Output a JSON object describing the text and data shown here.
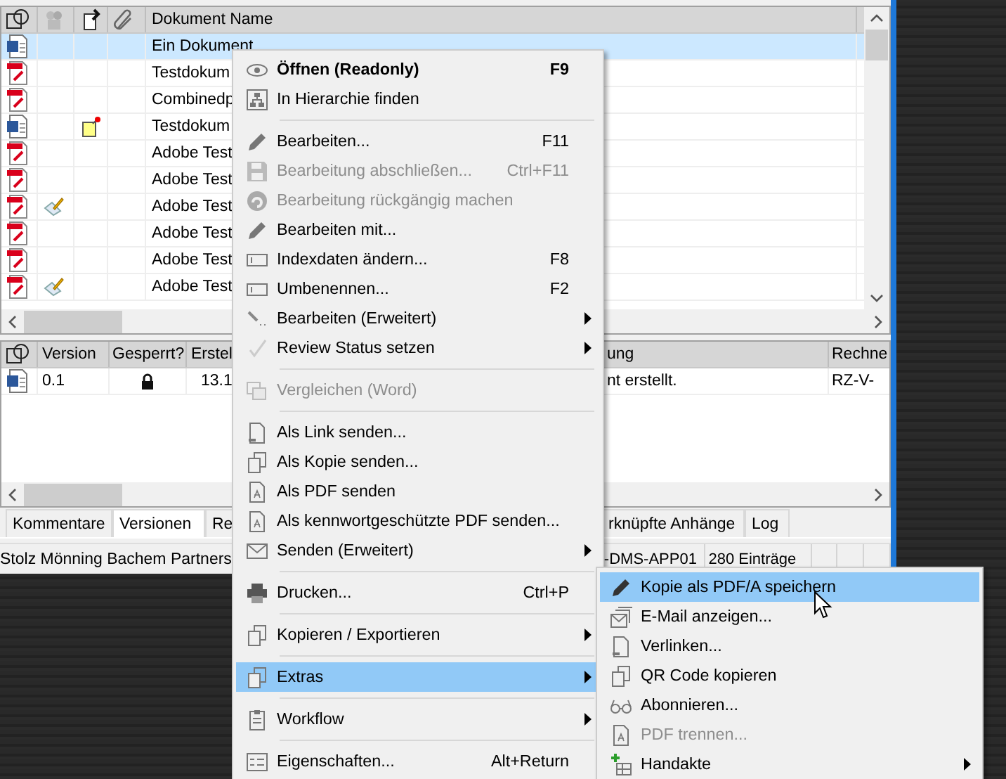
{
  "document_table": {
    "name_column": "Dokument Name",
    "rows": [
      {
        "kind": "word",
        "name": "Ein Dokument",
        "selected": true,
        "edited": false,
        "note": false
      },
      {
        "kind": "pdf",
        "name": "Testdokum",
        "selected": false,
        "edited": false,
        "note": false
      },
      {
        "kind": "pdf",
        "name": "Combinedp",
        "selected": false,
        "edited": false,
        "note": false
      },
      {
        "kind": "word",
        "name": "Testdokum",
        "selected": false,
        "edited": false,
        "note": true
      },
      {
        "kind": "pdf",
        "name": "Adobe Test",
        "selected": false,
        "edited": false,
        "note": false
      },
      {
        "kind": "pdf",
        "name": "Adobe Test",
        "selected": false,
        "edited": false,
        "note": false
      },
      {
        "kind": "pdf",
        "name": "Adobe Test",
        "selected": false,
        "edited": true,
        "note": false
      },
      {
        "kind": "pdf",
        "name": "Adobe Test",
        "selected": false,
        "edited": false,
        "note": false
      },
      {
        "kind": "pdf",
        "name": "Adobe Test",
        "selected": false,
        "edited": false,
        "note": false
      },
      {
        "kind": "pdf",
        "name": "Adobe Test",
        "selected": false,
        "edited": true,
        "note": false
      }
    ]
  },
  "version_table": {
    "columns": [
      "Version",
      "Gesperrt?",
      "Erstel",
      "ung",
      "Rechne"
    ],
    "rows": [
      {
        "kind": "word",
        "version": "0.1",
        "locked": true,
        "column_3": "13.1",
        "column_4": "nt erstellt.",
        "column_5": "RZ-V-"
      }
    ]
  },
  "tabs": [
    {
      "label": "Kommentare",
      "selected": false
    },
    {
      "label": "Versionen",
      "selected": true
    },
    {
      "label": "Re",
      "selected": false
    },
    {
      "label": "rknüpfte Anhänge",
      "selected": false
    },
    {
      "label": "Log",
      "selected": false
    }
  ],
  "status_bar": [
    "Stolz Mönning Bachem Partners",
    "-DMS-APP01",
    "280 Einträge"
  ],
  "context_menu": [
    {
      "kind": "item",
      "label": "Öffnen (Readonly)",
      "shortcut": "F9",
      "default": true,
      "disabled": false,
      "submenu": false,
      "selected": false
    },
    {
      "kind": "item",
      "label": "In Hierarchie finden",
      "disabled": false,
      "submenu": false,
      "selected": false
    },
    {
      "kind": "separator"
    },
    {
      "kind": "item",
      "label": "Bearbeiten...",
      "shortcut": "F11",
      "disabled": false,
      "submenu": false,
      "selected": false
    },
    {
      "kind": "item",
      "label": "Bearbeitung abschließen...",
      "shortcut": "Ctrl+F11",
      "disabled": true,
      "submenu": false,
      "selected": false
    },
    {
      "kind": "item",
      "label": "Bearbeitung rückgängig machen",
      "disabled": true,
      "submenu": false,
      "selected": false
    },
    {
      "kind": "item",
      "label": "Bearbeiten mit...",
      "disabled": false,
      "submenu": false,
      "selected": false
    },
    {
      "kind": "item",
      "label": "Indexdaten ändern...",
      "shortcut": "F8",
      "disabled": false,
      "submenu": false,
      "selected": false
    },
    {
      "kind": "item",
      "label": "Umbenennen...",
      "shortcut": "F2",
      "disabled": false,
      "submenu": false,
      "selected": false
    },
    {
      "kind": "item",
      "label": "Bearbeiten (Erweitert)",
      "disabled": false,
      "submenu": true,
      "selected": false
    },
    {
      "kind": "item",
      "label": "Review Status setzen",
      "disabled": false,
      "submenu": true,
      "selected": false
    },
    {
      "kind": "separator"
    },
    {
      "kind": "item",
      "label": "Vergleichen (Word)",
      "disabled": true,
      "submenu": false,
      "selected": false
    },
    {
      "kind": "separator"
    },
    {
      "kind": "item",
      "label": "Als Link senden...",
      "disabled": false,
      "submenu": false,
      "selected": false
    },
    {
      "kind": "item",
      "label": "Als Kopie senden...",
      "disabled": false,
      "submenu": false,
      "selected": false
    },
    {
      "kind": "item",
      "label": "Als PDF senden",
      "disabled": false,
      "submenu": false,
      "selected": false
    },
    {
      "kind": "item",
      "label": "Als kennwortgeschützte PDF senden...",
      "disabled": false,
      "submenu": false,
      "selected": false
    },
    {
      "kind": "item",
      "label": "Senden (Erweitert)",
      "disabled": false,
      "submenu": true,
      "selected": false
    },
    {
      "kind": "separator"
    },
    {
      "kind": "item",
      "label": "Drucken...",
      "shortcut": "Ctrl+P",
      "disabled": false,
      "submenu": false,
      "selected": false
    },
    {
      "kind": "separator"
    },
    {
      "kind": "item",
      "label": "Kopieren / Exportieren",
      "disabled": false,
      "submenu": true,
      "selected": false
    },
    {
      "kind": "separator"
    },
    {
      "kind": "item",
      "label": "Extras",
      "disabled": false,
      "submenu": true,
      "selected": true
    },
    {
      "kind": "separator"
    },
    {
      "kind": "item",
      "label": "Workflow",
      "disabled": false,
      "submenu": true,
      "selected": false
    },
    {
      "kind": "separator"
    },
    {
      "kind": "item",
      "label": "Eigenschaften...",
      "shortcut": "Alt+Return",
      "disabled": false,
      "submenu": false,
      "selected": false
    }
  ],
  "submenu": [
    {
      "kind": "item",
      "label": "Kopie als PDF/A speichern",
      "disabled": false,
      "submenu": false,
      "selected": true
    },
    {
      "kind": "item",
      "label": "E-Mail anzeigen...",
      "disabled": false,
      "submenu": false,
      "selected": false
    },
    {
      "kind": "item",
      "label": "Verlinken...",
      "disabled": false,
      "submenu": false,
      "selected": false
    },
    {
      "kind": "item",
      "label": "QR Code kopieren",
      "disabled": false,
      "submenu": false,
      "selected": false
    },
    {
      "kind": "item",
      "label": "Abonnieren...",
      "disabled": false,
      "submenu": false,
      "selected": false
    },
    {
      "kind": "item",
      "label": "PDF trennen...",
      "disabled": true,
      "submenu": false,
      "selected": false
    },
    {
      "kind": "item",
      "label": "Handakte",
      "disabled": false,
      "submenu": true,
      "selected": false
    }
  ]
}
